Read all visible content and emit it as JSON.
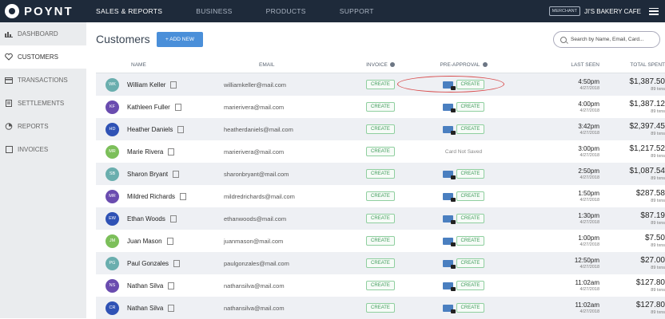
{
  "brand": {
    "logo_text": "POYNT"
  },
  "nav": [
    {
      "label": "SALES & REPORTS",
      "active": true
    },
    {
      "label": "BUSINESS",
      "active": false
    },
    {
      "label": "PRODUCTS",
      "active": false
    },
    {
      "label": "SUPPORT",
      "active": false
    }
  ],
  "merchant": {
    "badge": "MERCHANT",
    "name": "JI'S BAKERY CAFE"
  },
  "sidebar": {
    "items": [
      {
        "label": "DASHBOARD",
        "icon": "chart-icon"
      },
      {
        "label": "CUSTOMERS",
        "icon": "heart-icon",
        "active": true
      },
      {
        "label": "TRANSACTIONS",
        "icon": "card-icon"
      },
      {
        "label": "SETTLEMENTS",
        "icon": "document-icon"
      },
      {
        "label": "REPORTS",
        "icon": "reports-icon"
      },
      {
        "label": "INVOICES",
        "icon": "invoice-icon"
      }
    ]
  },
  "page": {
    "title": "Customers",
    "add_button": "+ ADD NEW",
    "search_placeholder": "Search by Name, Email, Card..."
  },
  "table": {
    "headers": {
      "name": "NAME",
      "email": "EMAIL",
      "invoice": "INVOICE",
      "preapproval": "PRE-APPROVAL",
      "last_seen": "LAST SEEN",
      "total_spent": "TOTAL SPENT"
    },
    "create_label": "CREATE",
    "rows": [
      {
        "initials": "WK",
        "color": "#6aaeae",
        "name": "William Keller",
        "email": "williamkeller@mail.com",
        "pre": "card",
        "time": "4:50pm",
        "date": "4/27/2018",
        "amount": "$1,387.50",
        "txns": "89 txns"
      },
      {
        "initials": "KF",
        "color": "#6a4caf",
        "name": "Kathleen Fuller",
        "email": "marierivera@mail.com",
        "pre": "card",
        "time": "4:00pm",
        "date": "4/27/2018",
        "amount": "$1,387.12",
        "txns": "89 txns"
      },
      {
        "initials": "HD",
        "color": "#2f52b5",
        "name": "Heather Daniels",
        "email": "heatherdaniels@mail.com",
        "pre": "card",
        "time": "3:42pm",
        "date": "4/27/2018",
        "amount": "$2,397.45",
        "txns": "89 txns"
      },
      {
        "initials": "MR",
        "color": "#7cbf5a",
        "name": "Marie Rivera",
        "email": "marierivera@mail.com",
        "pre": "none",
        "not_saved": "Card Not Saved",
        "time": "3:00pm",
        "date": "4/27/2018",
        "amount": "$1,217.52",
        "txns": "89 txns"
      },
      {
        "initials": "SB",
        "color": "#6aaeae",
        "name": "Sharon Bryant",
        "email": "sharonbryant@mail.com",
        "pre": "card",
        "time": "2:50pm",
        "date": "4/27/2018",
        "amount": "$1,087.54",
        "txns": "89 txns"
      },
      {
        "initials": "MR",
        "color": "#6a4caf",
        "name": "Mildred Richards",
        "email": "mildredrichards@mail.com",
        "pre": "card",
        "time": "1:50pm",
        "date": "4/27/2018",
        "amount": "$287.58",
        "txns": "89 txns"
      },
      {
        "initials": "EW",
        "color": "#2f52b5",
        "name": "Ethan Woods",
        "email": "ethanwoods@mail.com",
        "pre": "card",
        "time": "1:30pm",
        "date": "4/27/2018",
        "amount": "$87.19",
        "txns": "89 txns"
      },
      {
        "initials": "JM",
        "color": "#7cbf5a",
        "name": "Juan Mason",
        "email": "juanmason@mail.com",
        "pre": "card",
        "time": "1:00pm",
        "date": "4/27/2018",
        "amount": "$7.50",
        "txns": "89 txns"
      },
      {
        "initials": "PG",
        "color": "#6aaeae",
        "name": "Paul Gonzales",
        "email": "paulgonzales@mail.com",
        "pre": "card",
        "time": "12:50pm",
        "date": "4/27/2018",
        "amount": "$27.00",
        "txns": "89 txns"
      },
      {
        "initials": "NS",
        "color": "#6a4caf",
        "name": "Nathan Silva",
        "email": "nathansilva@mail.com",
        "pre": "card",
        "time": "11:02am",
        "date": "4/27/2018",
        "amount": "$127.80",
        "txns": "89 txns"
      },
      {
        "initials": "CR",
        "color": "#2f52b5",
        "name": "Nathan Silva",
        "email": "nathansilva@mail.com",
        "pre": "card",
        "time": "11:02am",
        "date": "4/27/2018",
        "amount": "$127.80",
        "txns": "89 txns"
      }
    ]
  }
}
